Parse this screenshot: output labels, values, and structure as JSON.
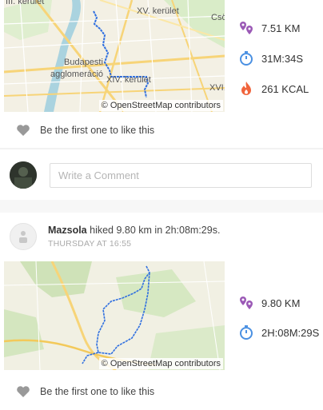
{
  "post1": {
    "map": {
      "labels": [
        "XV. kerület",
        "Budapesti",
        "agglomeráció",
        "XIV. kerület",
        "XVI.",
        "III. kerület",
        "Csö"
      ],
      "attribution": "© OpenStreetMap contributors"
    },
    "stats": [
      {
        "icon": "distance-icon",
        "value": "7.51 KM",
        "color": "#9b59b6"
      },
      {
        "icon": "timer-icon",
        "value": "31M:34S",
        "color": "#4a90e2"
      },
      {
        "icon": "calories-icon",
        "value": "261 KCAL",
        "color": "#f0643c"
      }
    ],
    "like_text": "Be the first one to like this"
  },
  "comment": {
    "placeholder": "Write a Comment"
  },
  "post2": {
    "user": "Mazsola",
    "action": " hiked ",
    "distance": "9.80 km",
    "in_word": " in ",
    "duration": "2h:08m:29s.",
    "timestamp": "THURSDAY AT 16:55",
    "map": {
      "attribution": "© OpenStreetMap contributors"
    },
    "stats": [
      {
        "icon": "distance-icon",
        "value": "9.80 KM",
        "color": "#9b59b6"
      },
      {
        "icon": "timer-icon",
        "value": "2H:08M:29S",
        "color": "#4a90e2"
      }
    ],
    "like_text": "Be the first one to like this"
  }
}
